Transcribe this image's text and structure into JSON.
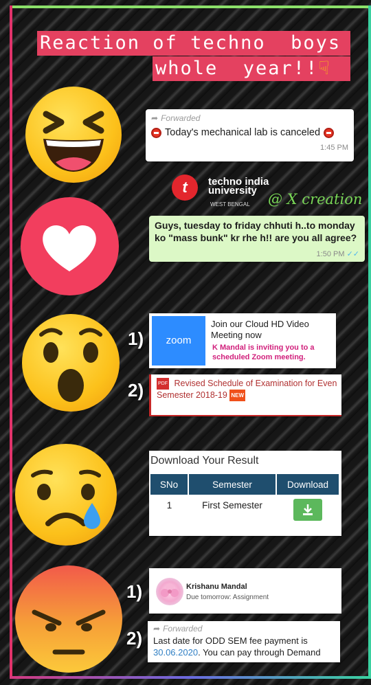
{
  "title": {
    "line1": "Reaction of techno  boys",
    "line2": "whole  year!!"
  },
  "icons": {
    "laugh": "laughing-emoji-icon",
    "heart": "heart-emoji-icon",
    "wow": "surprised-emoji-icon",
    "sad": "crying-emoji-icon",
    "angry": "angry-emoji-icon",
    "pointer": "pointing-down-icon"
  },
  "card1": {
    "forwarded": "Forwarded",
    "message": "Today's mechanical lab is canceled",
    "time": "1:45 PM"
  },
  "logo": {
    "name_line1": "techno india",
    "name_line2": "university",
    "region": "WEST BENGAL",
    "credit": "@ X creation"
  },
  "card2": {
    "message": "Guys, tuesday to friday chhuti h..to monday ko \"mass bunk\" kr rhe h!! are you all agree?",
    "time": "1:50 PM"
  },
  "wow_section": {
    "num1": "1)",
    "num2": "2)",
    "zoom_logo": "zoom",
    "zoom_title": "Join our Cloud HD Video Meeting now",
    "zoom_invite": "K Mandal is inviting you to a scheduled Zoom meeting.",
    "pdf_badge": "PDF",
    "exam_notice": "Revised Schedule of Examination for Even Semester 2018-19",
    "new_badge": "NEW"
  },
  "result_card": {
    "title": "Download Your Result",
    "headers": [
      "SNo",
      "Semester",
      "Download"
    ],
    "rows": [
      {
        "sno": "1",
        "semester": "First Semester"
      }
    ]
  },
  "angry_section": {
    "num1": "1)",
    "num2": "2)",
    "sender": "Krishanu Mandal",
    "notification": "Due tomorrow: Assignment",
    "forwarded": "Forwarded",
    "fee_text": "Last date for ODD SEM fee payment is",
    "fee_date": "30.06.2020",
    "fee_rest": ". You can pay through Demand"
  },
  "colors": {
    "title_bg": "#e44160",
    "frame_green": "#8ce06a",
    "frame_pink": "#e2336b",
    "zoom_blue": "#2d8cff",
    "table_header": "#1f4e6e",
    "download_green": "#5cb85c",
    "logo_red": "#e3262d"
  }
}
